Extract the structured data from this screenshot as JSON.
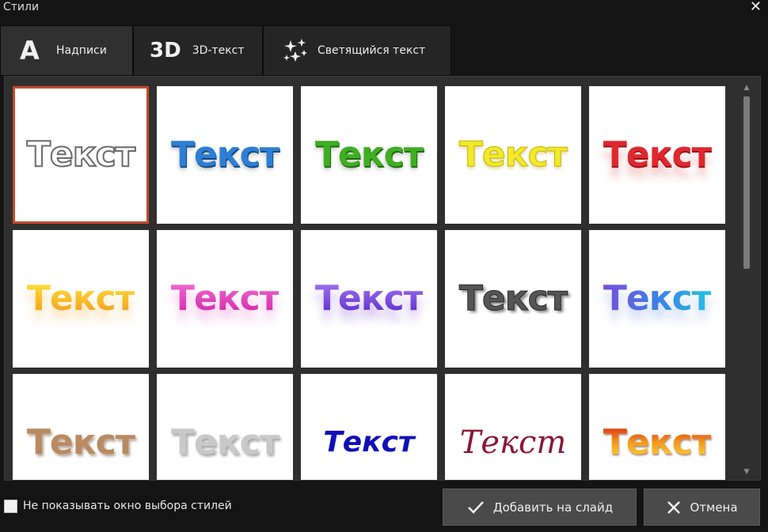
{
  "window": {
    "title": "Стили",
    "close_glyph": "✕"
  },
  "tabs": [
    {
      "label": "Надписи",
      "icon": "letter-a-icon",
      "glyph": "A",
      "active": true
    },
    {
      "label": "3D-текст",
      "icon": "3d-icon",
      "glyph": "3D",
      "active": false
    },
    {
      "label": "Светящийся текст",
      "icon": "sparkle-icon",
      "active": false
    }
  ],
  "styles": [
    {
      "text": "Текст",
      "style": "outline-white"
    },
    {
      "text": "Текст",
      "style": "blue"
    },
    {
      "text": "Текст",
      "style": "green"
    },
    {
      "text": "Текст",
      "style": "yellow"
    },
    {
      "text": "Текст",
      "style": "red"
    },
    {
      "text": "Текст",
      "style": "orange-gradient"
    },
    {
      "text": "Текст",
      "style": "pink"
    },
    {
      "text": "Текст",
      "style": "purple"
    },
    {
      "text": "Текст",
      "style": "dark-gray-shadow"
    },
    {
      "text": "Текст",
      "style": "blue-rainbow"
    },
    {
      "text": "Текст",
      "style": "tan-shadow"
    },
    {
      "text": "Текст",
      "style": "silver-shadow"
    },
    {
      "text": "Текст",
      "style": "dark-blue-italic"
    },
    {
      "text": "Текст",
      "style": "maroon-script"
    },
    {
      "text": "Текст",
      "style": "fire-gradient"
    }
  ],
  "selected_index": 0,
  "scrollbar": {
    "up_glyph": "▲",
    "down_glyph": "▼"
  },
  "footer": {
    "checkbox_label": "Не показывать окно выбора стилей",
    "checkbox_checked": false,
    "add_button_label": "Добавить на слайд",
    "cancel_button_label": "Отмена"
  },
  "colors": {
    "background": "#141414",
    "panel": "#2f2f2f",
    "tab_active": "#303030",
    "tab": "#252525",
    "selection": "#c24a2a",
    "button": "#4a4a4a"
  }
}
